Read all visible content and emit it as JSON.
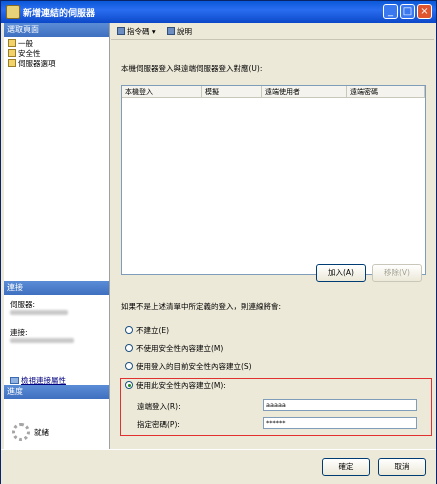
{
  "window": {
    "title": "新增連結的伺服器",
    "min": "_",
    "max": "□",
    "close": "×"
  },
  "left": {
    "select_page_header": "選取頁面",
    "nav_items": [
      "一般",
      "安全性",
      "伺服器選項"
    ],
    "connection_header": "連接",
    "server_label": "伺服器:",
    "connection_label": "連接:",
    "view_link": "檢視連接屬性",
    "progress_header": "進度",
    "progress_status": "就緒"
  },
  "toolbar": {
    "script": "指令碼",
    "script_dropdown": "▾",
    "help": "說明"
  },
  "main": {
    "mapping_description": "本機伺服器登入與遠端伺服器登入對應(U):",
    "grid_headers": [
      "本機登入",
      "模擬",
      "遠端使用者",
      "遠端密碼"
    ],
    "add_button": "加入(A)",
    "remove_button": "移除(V)",
    "fallback_text": "如果不是上述清單中所定義的登入，則連線將會:",
    "options": [
      {
        "label": "不建立(E)",
        "selected": false
      },
      {
        "label": "不使用安全性內容建立(M)",
        "selected": false
      },
      {
        "label": "使用登入的目前安全性內容建立(S)",
        "selected": false
      },
      {
        "label": "使用此安全性內容建立(M):",
        "selected": true
      }
    ],
    "remote_login_label": "遠端登入(R):",
    "remote_login_value": "aaaaa",
    "password_label": "指定密碼(P):",
    "password_value": "******"
  },
  "footer": {
    "ok": "確定",
    "cancel": "取消"
  }
}
